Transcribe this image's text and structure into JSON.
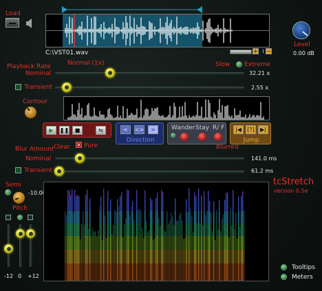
{
  "load": {
    "label": "Load",
    "icon": "load-icon",
    "speaker_icon": "speaker-icon"
  },
  "file": {
    "path": "C:\\VST01.wav"
  },
  "level": {
    "label": "Level",
    "value": "0.00 dB"
  },
  "playback_rate": {
    "label": "Playback Rate",
    "mode": "Nominal",
    "normal_label": "Normal (1x)",
    "slow_label": "Slow",
    "extreme_label": "Extreme",
    "value": "32.21 x",
    "position": 0.29
  },
  "transient_rate": {
    "label": "Transient",
    "value": "2.55 x",
    "position": 0.06
  },
  "contour": {
    "label": "Contour"
  },
  "transport": {
    "icons": [
      "play-icon",
      "pause-icon",
      "stop-icon",
      "loop-icon"
    ]
  },
  "direction": {
    "label": "Direction",
    "icons": [
      "left-arrow-icon",
      "bidirectional-icon",
      "right-arrow-icon"
    ]
  },
  "wander": {
    "wander_label": "Wander",
    "stay_label": "Stay",
    "rf_label": "R/ F"
  },
  "jump": {
    "label": "Jump",
    "icons": [
      "jump-start-icon",
      "jump-random-icon",
      "jump-end-icon"
    ]
  },
  "blur": {
    "label": "Blur Amount",
    "mode": "Nominal",
    "clear_label": "Clear",
    "pure_label": "Pure",
    "blurred_label": "Blurred",
    "value": "141.0 ms",
    "position": 0.13
  },
  "blur_transient": {
    "label": "Transient",
    "value": "61.2 ms",
    "position": 0.02
  },
  "pitch": {
    "semi_label": "Semi",
    "pitch_label": "Pitch",
    "value": "-10.00"
  },
  "faders": {
    "labels": [
      "-12",
      "0",
      "+12"
    ],
    "levels": [
      0.43,
      0.79,
      0.79
    ]
  },
  "brand": {
    "title": "tcStretch",
    "version": "version  0.5e"
  },
  "options": {
    "tooltips": "Tooltips",
    "meters": "Meters"
  },
  "colors": {
    "accent": "#e0322c",
    "highlight": "#d8d220",
    "selection": "#1f9dbf"
  }
}
